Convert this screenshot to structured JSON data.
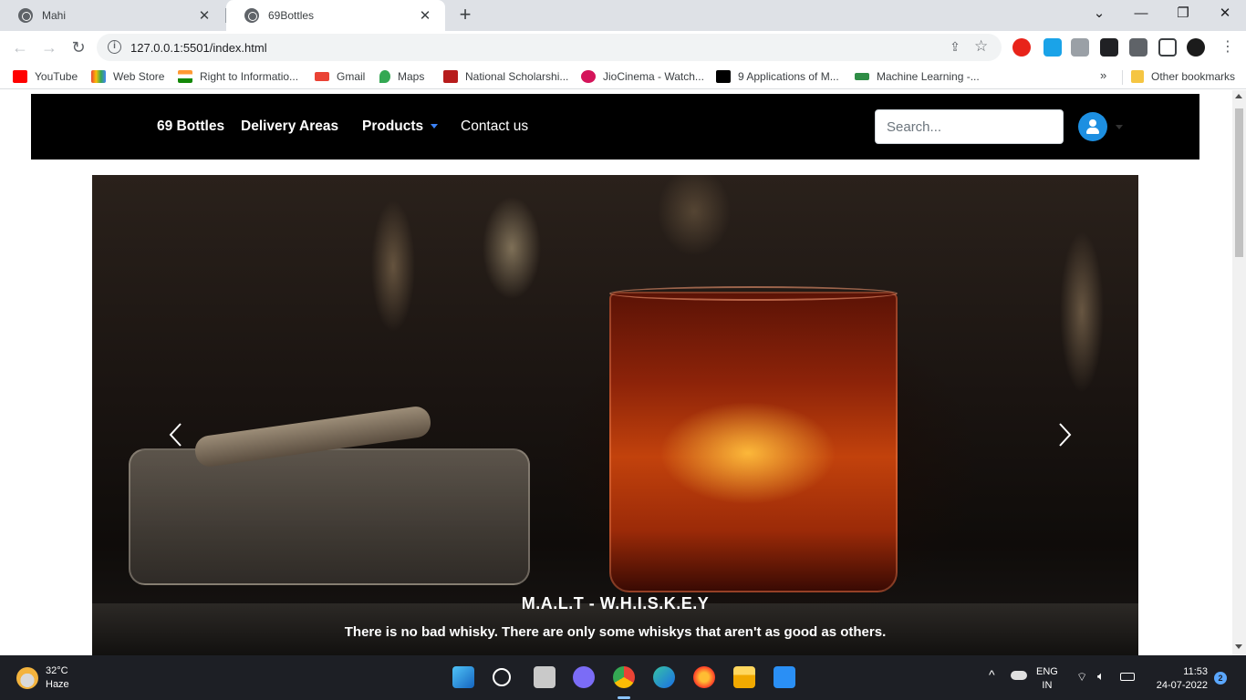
{
  "browser": {
    "tabs": [
      {
        "title": "Mahi",
        "active": false
      },
      {
        "title": "69Bottles",
        "active": true
      }
    ],
    "close_glyph": "✕",
    "new_tab_glyph": "+",
    "window_controls": {
      "dropdown": "⌄",
      "minimize": "—",
      "restore": "❐",
      "close": "✕"
    },
    "url": "127.0.0.1:5501/index.html",
    "nav": {
      "back": "←",
      "forward": "→",
      "reload": "↻"
    }
  },
  "bookmarks": {
    "items": [
      {
        "label": "YouTube",
        "color": "#ff0000"
      },
      {
        "label": "Web Store",
        "color": "#4285f4"
      },
      {
        "label": "Right to Informatio...",
        "color": "#ff9933"
      },
      {
        "label": "Gmail",
        "color": "#ea4335"
      },
      {
        "label": "Maps",
        "color": "#34a853"
      },
      {
        "label": "National Scholarshi...",
        "color": "#b71c1c"
      },
      {
        "label": "JioCinema - Watch...",
        "color": "#d4145a"
      },
      {
        "label": "9 Applications of M...",
        "color": "#000000"
      },
      {
        "label": "Machine Learning -...",
        "color": "#2f8d46"
      }
    ],
    "more": "»",
    "other": "Other bookmarks"
  },
  "site": {
    "brand": "69 Bottles",
    "nav": {
      "delivery": "Delivery Areas",
      "products": "Products",
      "contact": "Contact us"
    },
    "search_placeholder": "Search...",
    "accent_color": "#1d8fe1"
  },
  "carousel": {
    "caption_title": "M.A.L.T - W.H.I.S.K.E.Y",
    "caption_text": "There is no bad whisky. There are only some whiskys that aren't as good as others."
  },
  "taskbar": {
    "weather_temp": "32°C",
    "weather_desc": "Haze",
    "lang_top": "ENG",
    "lang_bottom": "IN",
    "time": "11:53",
    "date": "24-07-2022",
    "notifications": "2",
    "tray_chevron": "^"
  }
}
